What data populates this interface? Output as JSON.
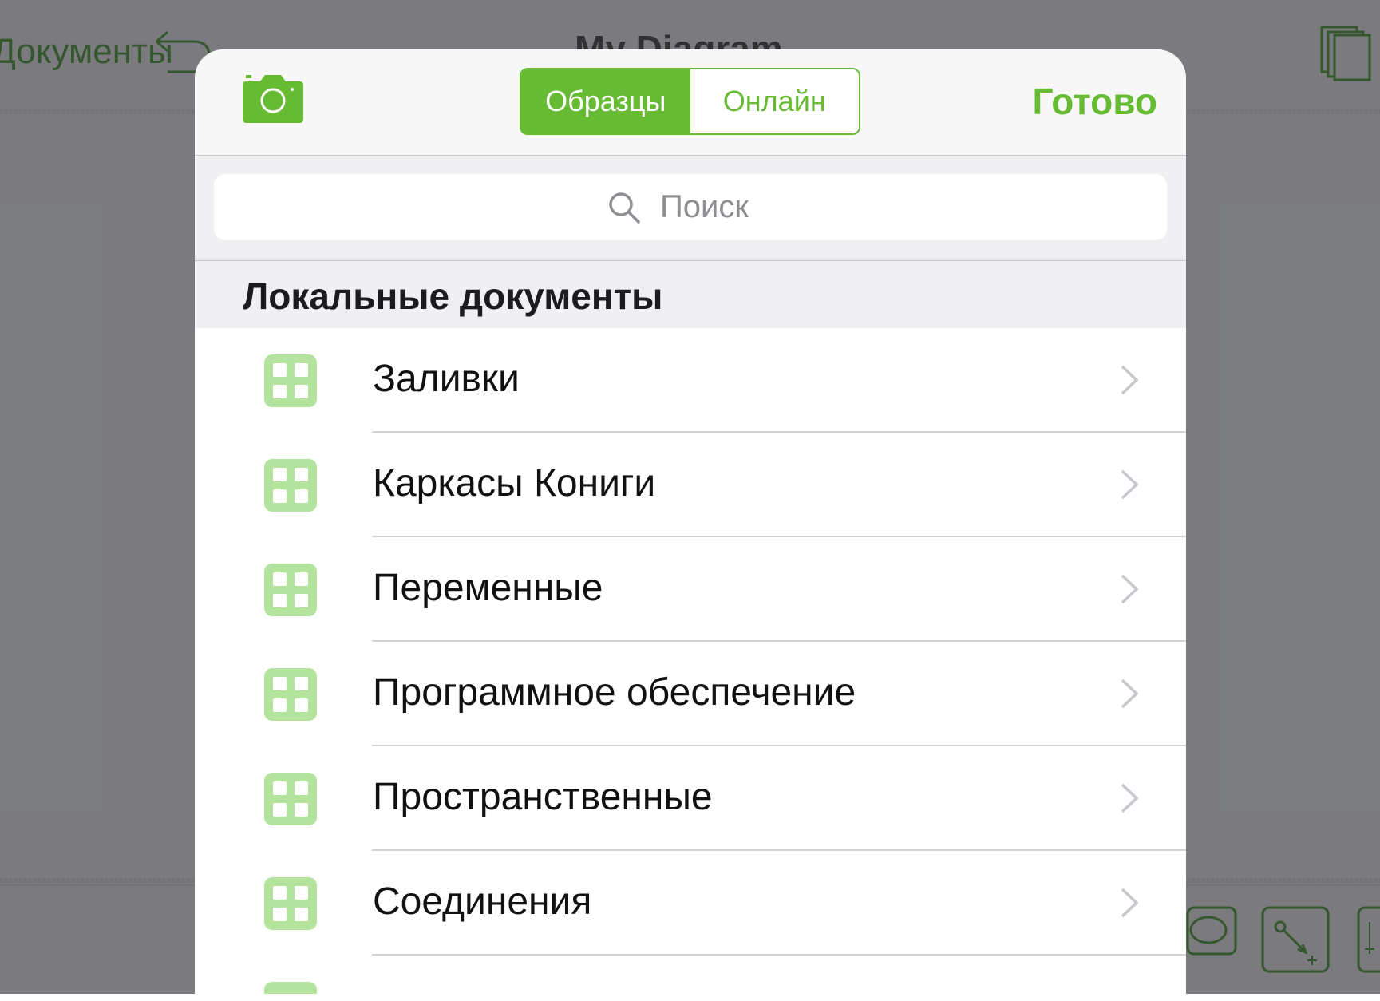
{
  "background": {
    "back_label": "Документы",
    "title": "My Diagram"
  },
  "popover": {
    "segments": [
      {
        "label": "Образцы",
        "active": true
      },
      {
        "label": "Онлайн",
        "active": false
      }
    ],
    "done_label": "Готово",
    "search": {
      "placeholder": "Поиск"
    },
    "section_title": "Локальные документы",
    "items": [
      {
        "label": "Заливки"
      },
      {
        "label": "Каркасы Кониги"
      },
      {
        "label": "Переменные"
      },
      {
        "label": "Программное обеспечение"
      },
      {
        "label": "Пространственные"
      },
      {
        "label": "Соединения"
      }
    ]
  },
  "colors": {
    "accent": "#66bb33",
    "icon_fill": "#b3e39c"
  }
}
